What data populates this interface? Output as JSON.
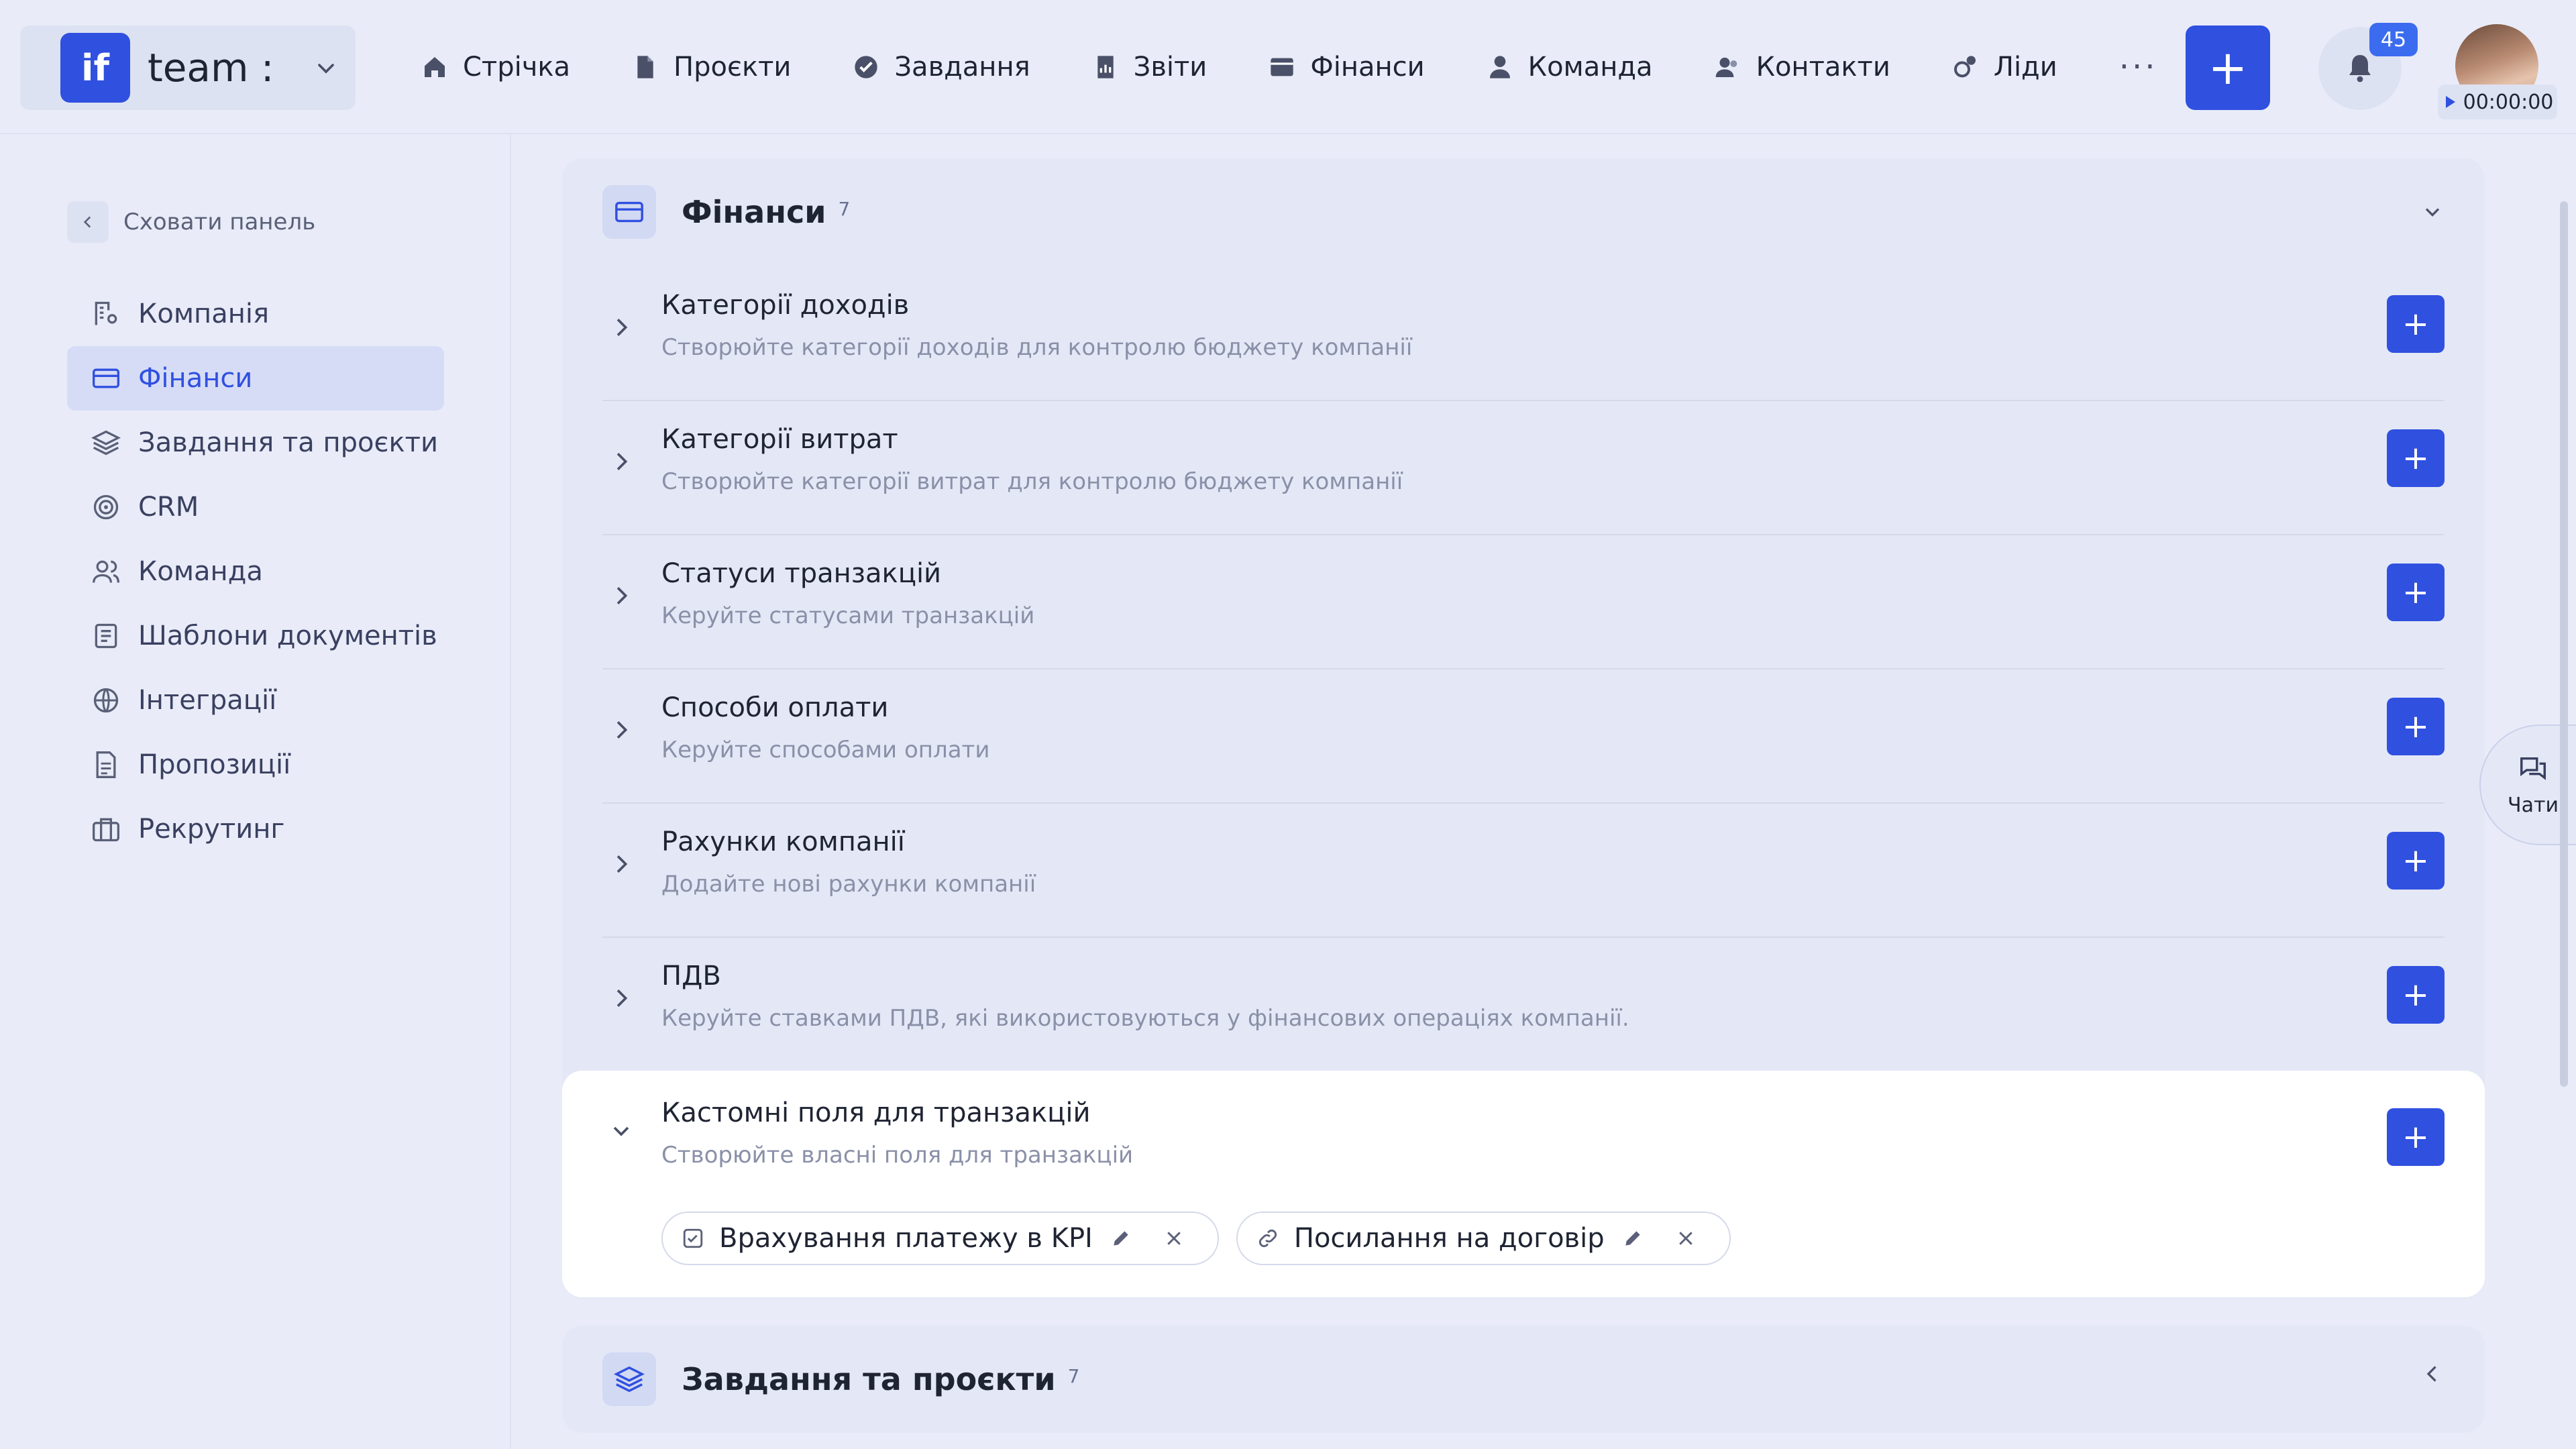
{
  "brand": {
    "logo": "if",
    "name": "team :"
  },
  "nav": [
    {
      "label": "Стрічка",
      "icon": "home-icon"
    },
    {
      "label": "Проєкти",
      "icon": "file-icon"
    },
    {
      "label": "Завдання",
      "icon": "check-circle-icon"
    },
    {
      "label": "Звіти",
      "icon": "report-icon"
    },
    {
      "label": "Фінанси",
      "icon": "card-icon"
    },
    {
      "label": "Команда",
      "icon": "user-icon"
    },
    {
      "label": "Контакти",
      "icon": "contacts-icon"
    },
    {
      "label": "Ліди",
      "icon": "leads-icon"
    }
  ],
  "nav_more": "···",
  "header": {
    "add_label": "+",
    "notifications_count": "45",
    "timer": "00:00:00"
  },
  "sidebar": {
    "hide_label": "Сховати панель",
    "items": [
      {
        "label": "Компанія",
        "icon": "company-icon"
      },
      {
        "label": "Фінанси",
        "icon": "card-icon"
      },
      {
        "label": "Завдання та проєкти",
        "icon": "layers-icon"
      },
      {
        "label": "CRM",
        "icon": "target-icon"
      },
      {
        "label": "Команда",
        "icon": "users-icon"
      },
      {
        "label": "Шаблони документів",
        "icon": "document-template-icon"
      },
      {
        "label": "Інтеграції",
        "icon": "globe-icon"
      },
      {
        "label": "Пропозиції",
        "icon": "proposal-icon"
      },
      {
        "label": "Рекрутинг",
        "icon": "briefcase-icon"
      }
    ],
    "active_index": 1
  },
  "finance_panel": {
    "title": "Фінанси",
    "count": "7",
    "rows": [
      {
        "title": "Категорії доходів",
        "desc": "Створюйте категорії доходів для контролю бюджету компанії"
      },
      {
        "title": "Категорії витрат",
        "desc": "Створюйте категорії витрат для контролю бюджету компанії"
      },
      {
        "title": "Статуси транзакцій",
        "desc": "Керуйте статусами транзакцій"
      },
      {
        "title": "Способи оплати",
        "desc": "Керуйте способами оплати"
      },
      {
        "title": "Рахунки компанії",
        "desc": "Додайте нові рахунки компанії"
      },
      {
        "title": "ПДВ",
        "desc": "Керуйте ставками ПДВ, які використовуються у фінансових операціях компанії."
      }
    ],
    "expanded": {
      "title": "Кастомні поля для транзакцій",
      "desc": "Створюйте власні поля для транзакцій",
      "chips": [
        {
          "label": "Врахування платежу в KPI",
          "icon": "checkbox-icon"
        },
        {
          "label": "Посилання на договір",
          "icon": "link-icon"
        }
      ]
    }
  },
  "tasks_panel": {
    "title": "Завдання та проєкти",
    "count": "7"
  },
  "chats": {
    "label": "Чати"
  },
  "colors": {
    "accent": "#3050e0",
    "background": "#e9ecf8",
    "badge": "#3b6cf0"
  }
}
